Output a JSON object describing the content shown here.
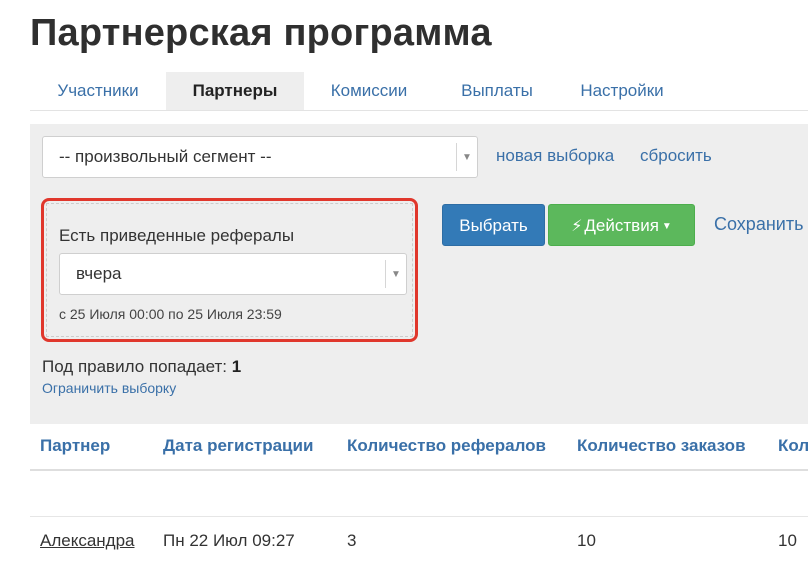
{
  "page": {
    "title": "Партнерская программа"
  },
  "tabs": [
    {
      "label": "Участники",
      "active": false
    },
    {
      "label": "Партнеры",
      "active": true
    },
    {
      "label": "Комиссии",
      "active": false
    },
    {
      "label": "Выплаты",
      "active": false
    },
    {
      "label": "Настройки",
      "active": false
    }
  ],
  "filter": {
    "segment_value": "-- произвольный сегмент --",
    "new_selection_link": "новая выборка",
    "reset_link": "сбросить",
    "rule": {
      "label": "Есть приведенные рефералы",
      "period_value": "вчера",
      "range_text": "с 25 Июля 00:00 по 25 Июля 23:59"
    },
    "select_button": "Выбрать",
    "actions_button": "Действия",
    "save_link": "Сохранить",
    "matches_label": "Под правило попадает:",
    "matches_count": "1",
    "limit_link": "Ограничить выборку"
  },
  "table": {
    "columns": [
      "Партнер",
      "Дата регистрации",
      "Количество рефералов",
      "Количество заказов",
      "Кол"
    ],
    "rows": [
      {
        "partner": "Александра",
        "registered": "Пн 22 Июл 09:27",
        "referrals": "3",
        "orders": "10",
        "extra": "10"
      }
    ]
  },
  "colors": {
    "primary": "#337ab7",
    "success": "#5cb85c",
    "highlight": "#e0372c",
    "link": "#3a70a8"
  },
  "icons": {
    "actions": "bolt-icon",
    "dropdown": "caret-down-icon"
  }
}
